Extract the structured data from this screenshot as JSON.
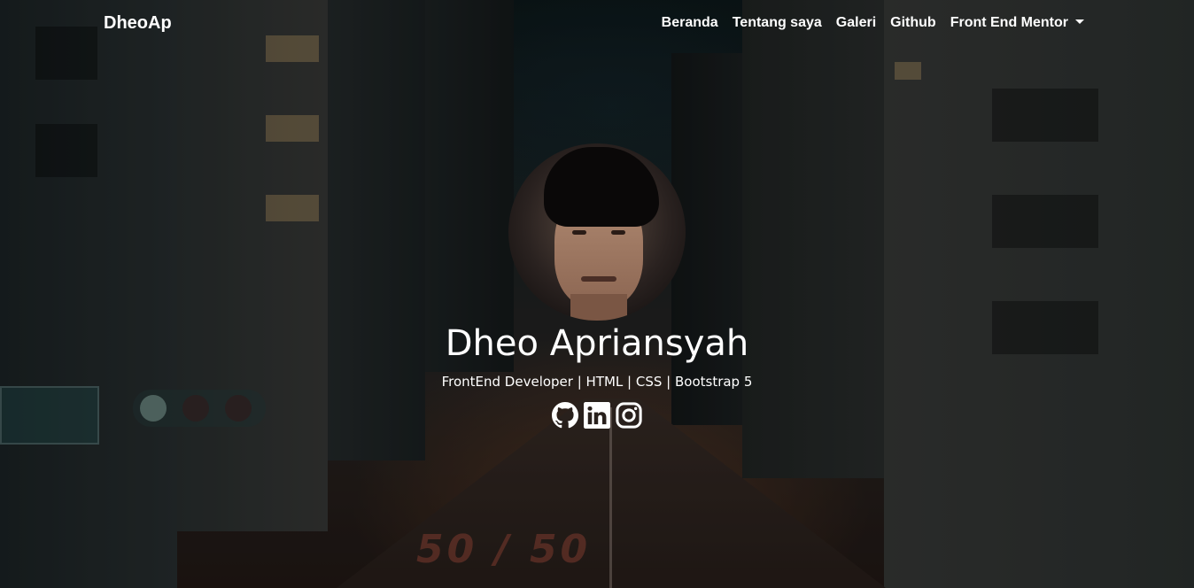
{
  "navbar": {
    "brand": "DheoAp",
    "links": [
      {
        "label": "Beranda"
      },
      {
        "label": "Tentang saya"
      },
      {
        "label": "Galeri"
      },
      {
        "label": "Github"
      },
      {
        "label": "Front End Mentor",
        "dropdown": true
      }
    ]
  },
  "profile": {
    "name": "Dheo Apriansyah",
    "tagline": "FrontEnd Developer | HTML | CSS | Bootstrap 5",
    "socials": [
      {
        "icon": "github-icon"
      },
      {
        "icon": "linkedin-icon"
      },
      {
        "icon": "instagram-icon"
      }
    ]
  },
  "colors": {
    "text": "#ffffff",
    "background": "#0b0f12"
  }
}
